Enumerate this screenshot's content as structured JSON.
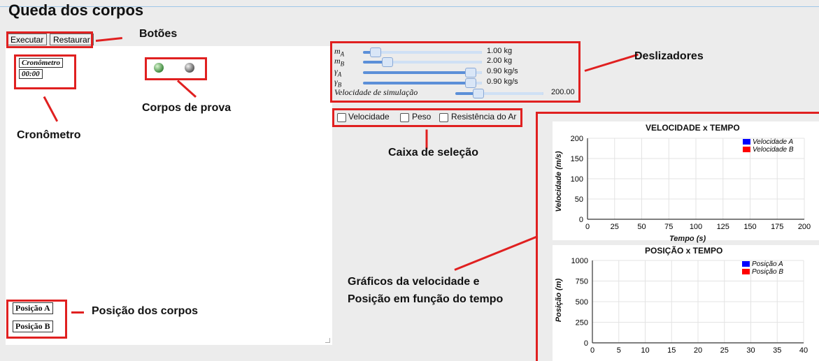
{
  "app": {
    "title": "Queda dos corpos"
  },
  "toolbar": {
    "run_label": "Executar",
    "reset_label": "Restaurar"
  },
  "stopwatch": {
    "title": "Cronômetro",
    "time": "00:00"
  },
  "positions": {
    "a_label": "Posição A",
    "b_label": "Posição B"
  },
  "sliders": [
    {
      "label": "m_A",
      "value": "1.00 kg",
      "fraction": 0.1
    },
    {
      "label": "m_B",
      "value": "2.00 kg",
      "fraction": 0.2
    },
    {
      "label": "γ_A",
      "value": "0.90 kg/s",
      "fraction": 0.9
    },
    {
      "label": "γ_B",
      "value": "0.90 kg/s",
      "fraction": 0.9
    },
    {
      "label": "Velocidade de simulação",
      "value": "200.00",
      "fraction": 0.25
    }
  ],
  "checkboxes": [
    {
      "label": "Velocidade",
      "checked": false
    },
    {
      "label": "Peso",
      "checked": false
    },
    {
      "label": "Resistência do Ar",
      "checked": false
    }
  ],
  "callouts": {
    "buttons": "Botões",
    "sliders": "Deslizadores",
    "bodies": "Corpos de prova",
    "stopwatch": "Cronômetro",
    "checkboxes": "Caixa de seleção",
    "charts_line1": "Gráficos da velocidade e",
    "charts_line2": "Posição em função do tempo",
    "positions": "Posição dos corpos"
  },
  "colors": {
    "series_a": "#0000ff",
    "series_b": "#ff0000",
    "annotation": "#e02020"
  },
  "chart_data": [
    {
      "type": "line",
      "title": "VELOCIDADE x TEMPO",
      "xlabel": "Tempo (s)",
      "ylabel": "Velocidade (m/s)",
      "xlim": [
        0,
        200
      ],
      "ylim": [
        0,
        200
      ],
      "x_ticks": [
        "0",
        "25",
        "50",
        "75",
        "100",
        "125",
        "150",
        "175",
        "200"
      ],
      "y_ticks": [
        "0",
        "50",
        "100",
        "150",
        "200"
      ],
      "series": [
        {
          "name": "Velocidade A",
          "color": "#0000ff",
          "values": []
        },
        {
          "name": "Velocidade B",
          "color": "#ff0000",
          "values": []
        }
      ],
      "grid": true,
      "legend": "top-right"
    },
    {
      "type": "line",
      "title": "POSIÇÃO x TEMPO",
      "ylabel": "Posição (m)",
      "xlim": [
        0,
        40
      ],
      "ylim": [
        0,
        1000
      ],
      "x_ticks": [
        "0",
        "5",
        "10",
        "15",
        "20",
        "25",
        "30",
        "35",
        "40"
      ],
      "y_ticks": [
        "0",
        "250",
        "500",
        "750",
        "1000"
      ],
      "series": [
        {
          "name": "Posição A",
          "color": "#0000ff",
          "values": []
        },
        {
          "name": "Posição B",
          "color": "#ff0000",
          "values": []
        }
      ],
      "grid": true,
      "legend": "top-right"
    }
  ]
}
